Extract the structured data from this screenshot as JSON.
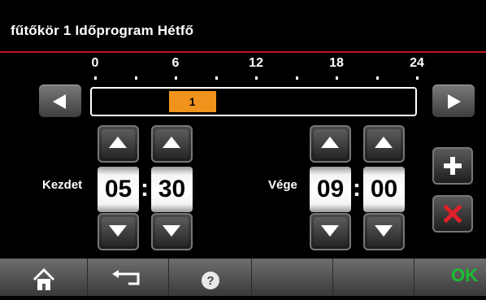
{
  "header": {
    "title": "fűtőkör 1 Időprogram Hétfő"
  },
  "timeline": {
    "hour_labels": [
      "0",
      "6",
      "12",
      "18",
      "24"
    ],
    "segment_label": "1",
    "segment_start_hour": 5.5,
    "segment_end_hour": 9.0,
    "segment_color": "#f0931c"
  },
  "start": {
    "label": "Kezdet",
    "hours": "05",
    "minutes": "30",
    "separator": ":"
  },
  "end": {
    "label": "Vége",
    "hours": "09",
    "minutes": "00",
    "separator": ":"
  },
  "buttons": {
    "add_icon": "plus-icon",
    "delete_icon": "x-icon"
  },
  "bottom_bar": {
    "home_icon": "home-icon",
    "back_icon": "back-arrow-icon",
    "help_icon": "help-icon",
    "ok_label": "OK"
  },
  "colors": {
    "accent_red": "#c41920",
    "ok_green": "#19c030",
    "delete_red": "#e0202a"
  }
}
